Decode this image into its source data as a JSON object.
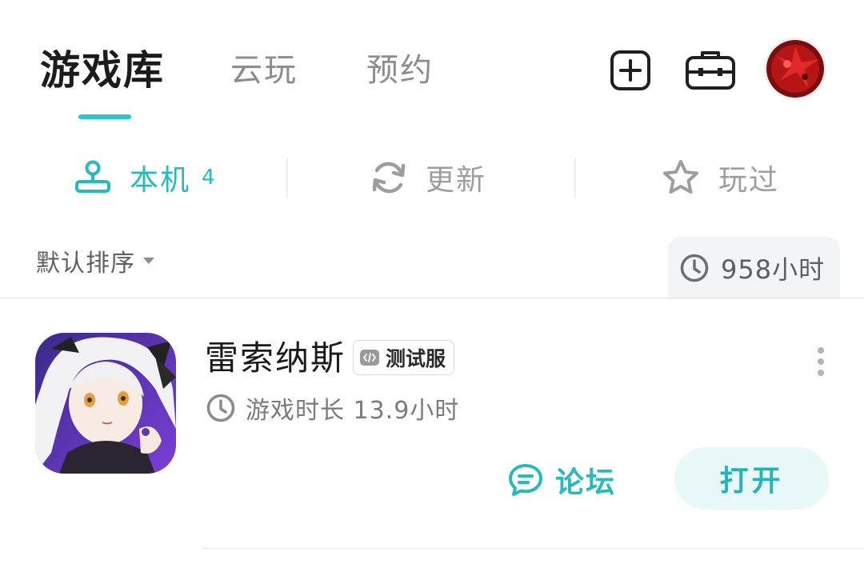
{
  "tabs": {
    "library": "游戏库",
    "cloud": "云玩",
    "reserve": "预约"
  },
  "subtabs": {
    "local": {
      "label": "本机",
      "count": "4"
    },
    "update": {
      "label": "更新"
    },
    "played": {
      "label": "玩过"
    }
  },
  "sort": {
    "label": "默认排序"
  },
  "total_playtime": "958小时",
  "game": {
    "title": "雷索纳斯",
    "badge": "测试服",
    "playtime": "游戏时长 13.9小时",
    "forum_label": "论坛",
    "open_label": "打开"
  },
  "colors": {
    "accent": "#2ec5c9",
    "muted": "#9d9d9d"
  },
  "icons": [
    "add-icon",
    "toolbox-icon",
    "avatar",
    "joystick-icon",
    "refresh-icon",
    "star-icon",
    "clock-icon",
    "code-icon",
    "more-icon",
    "chat-icon"
  ]
}
